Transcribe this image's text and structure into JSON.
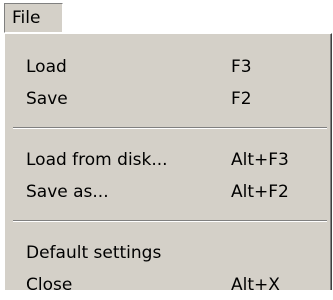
{
  "menubar": {
    "file_label": "File"
  },
  "menu": {
    "items": [
      {
        "label": "Load",
        "shortcut": "F3"
      },
      {
        "label": "Save",
        "shortcut": "F2"
      },
      {
        "label": "Load from disk...",
        "shortcut": "Alt+F3"
      },
      {
        "label": "Save as...",
        "shortcut": "Alt+F2"
      },
      {
        "label": "Default settings",
        "shortcut": ""
      },
      {
        "label": "Close",
        "shortcut": "Alt+X"
      }
    ]
  },
  "colors": {
    "menu_background": "#d4d0c8",
    "text": "#000000",
    "shadow": "#808080",
    "highlight": "#ffffff"
  }
}
